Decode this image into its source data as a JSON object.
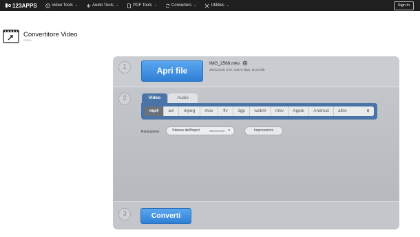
{
  "topbar": {
    "logo": "123APPS",
    "nav": [
      {
        "label": "Video Tools",
        "icon": "video-play-icon"
      },
      {
        "label": "Audio Tools",
        "icon": "audio-wave-icon"
      },
      {
        "label": "PDF Tools",
        "icon": "pdf-document-icon"
      },
      {
        "label": "Converters",
        "icon": "converter-cycle-icon"
      },
      {
        "label": "Utilities",
        "icon": "utilities-tools-icon"
      }
    ],
    "chevron": "⌄",
    "signin": "Sign In"
  },
  "app": {
    "title": "Convertitore Video",
    "subtitle": "online",
    "icon": "video-converter-icon"
  },
  "steps": {
    "step1_number": "1",
    "step2_number": "2",
    "step3_number": "3"
  },
  "file": {
    "open_button": "Apri file",
    "name": "IMG_2566.mkv",
    "meta": "3840x2160, 0:07, 53575 kbps, 50.04 Mb",
    "link_icon": "link-icon"
  },
  "tabs": {
    "video": "Video",
    "audio": "Audio",
    "active": "Video"
  },
  "formats": {
    "items": [
      "mp4",
      "avi",
      "mpeg",
      "mov",
      "flv",
      "3gp",
      "webm",
      "mkv",
      "Apple",
      "Android"
    ],
    "active": "mp4",
    "more": "altro"
  },
  "resolution": {
    "label": "Risoluzione:",
    "selected": "Stessa dell'input",
    "dimension": "3840x2160"
  },
  "settings_button": "Impostazioni",
  "convert_button": "Converti",
  "colors": {
    "accent_blue": "#2f7fd6",
    "tab_blue": "#4a74a8",
    "panel_gray": "#c3c6cb",
    "topbar": "#1f1f1f"
  }
}
